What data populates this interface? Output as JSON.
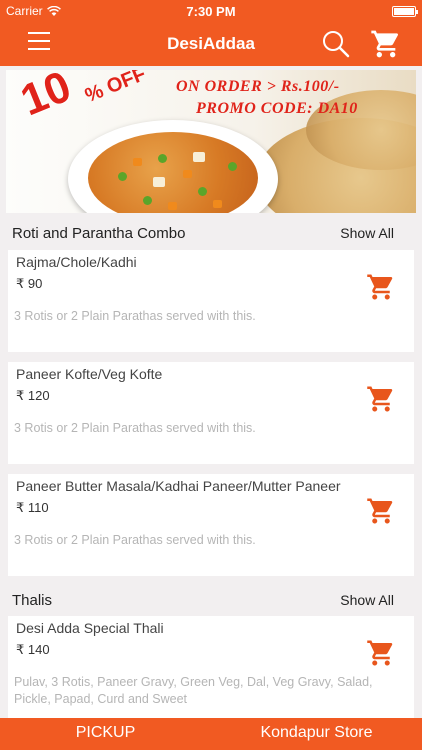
{
  "status_bar": {
    "carrier": "Carrier",
    "time": "7:30 PM"
  },
  "nav": {
    "title": "DesiAddaa",
    "icons": [
      "menu-icon",
      "search-icon",
      "cart-icon"
    ]
  },
  "banner": {
    "discount": "10",
    "discount_suffix": "% OFF",
    "line1": "ON ORDER > Rs.100/-",
    "line2": "PROMO CODE: DA10"
  },
  "sections": [
    {
      "title": "Roti and Parantha Combo",
      "show_all": "Show All",
      "items": [
        {
          "name": "Rajma/Chole/Kadhi",
          "price": "₹ 90",
          "description": "3 Rotis or 2 Plain  Parathas served with this."
        },
        {
          "name": "Paneer Kofte/Veg Kofte",
          "price": "₹ 120",
          "description": "3 Rotis or 2 Plain  Parathas served with this."
        },
        {
          "name": "Paneer Butter Masala/Kadhai Paneer/Mutter Paneer",
          "price": "₹ 110",
          "description": "3 Rotis or 2 Plain  Parathas served with this."
        }
      ]
    },
    {
      "title": "Thalis",
      "show_all": "Show All",
      "items": [
        {
          "name": "Desi Adda Special Thali",
          "price": "₹ 140",
          "description": "Pulav, 3 Rotis, Paneer Gravy, Green Veg, Dal, Veg Gravy, Salad, Pickle, Papad, Curd and Sweet"
        }
      ]
    }
  ],
  "bottom_bar": {
    "pickup": "PICKUP",
    "store": "Kondapur Store"
  },
  "colors": {
    "accent": "#f15a22",
    "cart_icon": "#e8561c",
    "background": "#f2eff0"
  }
}
